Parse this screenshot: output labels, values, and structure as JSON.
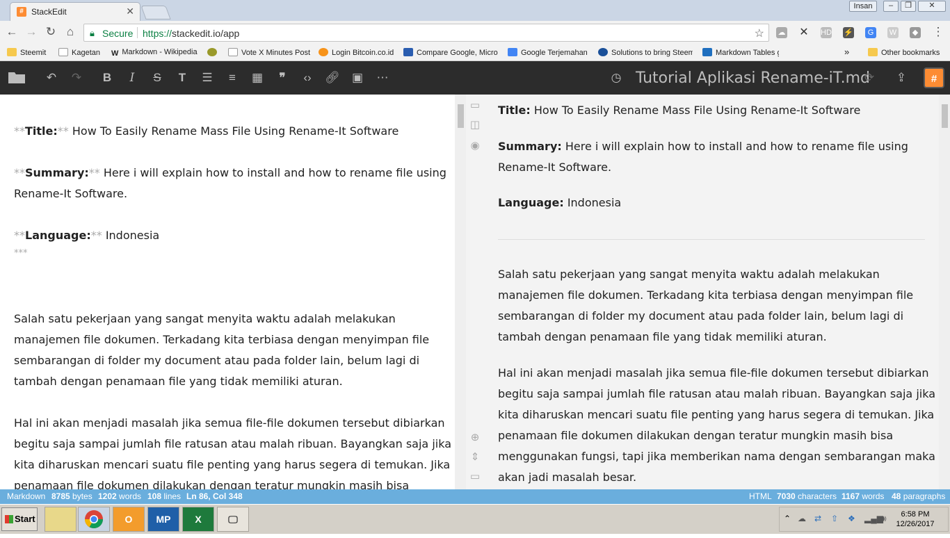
{
  "browser": {
    "tab_title": "StackEdit",
    "tab_close": "✕",
    "user": "Insan",
    "secure_label": "Secure",
    "url_scheme": "https://",
    "url_rest": "stackedit.io/app"
  },
  "bookmarks": [
    {
      "label": "Steemit",
      "icon": "folder-icon",
      "color": "#f6c94e"
    },
    {
      "label": "Kagetan",
      "icon": "page-icon",
      "color": "#ffffff"
    },
    {
      "label": "Markdown - Wikipedia",
      "icon": "wikipedia-icon",
      "color": "#ffffff"
    },
    {
      "label": "",
      "icon": "coin-icon",
      "color": "#9a9a2a"
    },
    {
      "label": "Vote X Minutes Post",
      "icon": "page-icon",
      "color": "#ffffff"
    },
    {
      "label": "Login Bitcoin.co.id",
      "icon": "bitcoin-icon",
      "color": "#f7931a"
    },
    {
      "label": "Compare Google, Micro",
      "icon": "shield-icon",
      "color": "#2a5db0"
    },
    {
      "label": "Google Terjemahan",
      "icon": "translate-icon",
      "color": "#4285f4"
    },
    {
      "label": "Solutions to bring Steem",
      "icon": "steem-icon",
      "color": "#1a5099"
    },
    {
      "label": "Markdown Tables gener",
      "icon": "table-icon",
      "color": "#1f6fbf"
    }
  ],
  "bookmarks_more": "»",
  "bookmarks_other": "Other bookmarks",
  "document_title": "Tutorial Aplikasi Rename-iT.md",
  "editor": {
    "title_mark_open": "**",
    "title_label": "Title:",
    "title_mark_close": "**",
    "title_text": " How To Easily Rename Mass File Using Rename-It Software",
    "summary_mark_open": "**",
    "summary_label": "Summary:",
    "summary_mark_close": "**",
    "summary_text": " Here i will explain how to install and how to rename file using",
    "summary_text2": "Rename-It Software.",
    "language_mark_open": "**",
    "language_label": "Language:",
    "language_mark_close": "**",
    "language_text": " Indonesia",
    "hr_mark": "***",
    "p1": [
      "Salah satu pekerjaan yang sangat menyita waktu adalah melakukan",
      "manajemen file dokumen. Terkadang kita terbiasa dengan menyimpan file",
      "sembarangan di folder my document atau pada folder lain, belum lagi di",
      "tambah dengan penamaan file yang tidak memiliki aturan."
    ],
    "p2": [
      "Hal ini akan menjadi masalah jika semua file-file dokumen tersebut dibiarkan",
      "begitu saja sampai jumlah file ratusan atau malah ribuan. Bayangkan saja jika",
      "kita diharuskan mencari suatu file penting yang harus segera di temukan. Jika",
      "penamaan file dokumen dilakukan dengan teratur mungkin masih bisa"
    ]
  },
  "preview": {
    "title_label": "Title:",
    "title_text": " How To Easily Rename Mass File Using Rename-It Software",
    "summary_label": "Summary:",
    "summary_text": " Here i will explain how to install and how to rename file using",
    "summary_text2": "Rename-It Software.",
    "language_label": "Language:",
    "language_text": " Indonesia",
    "p1": [
      "Salah satu pekerjaan yang sangat menyita waktu adalah melakukan",
      "manajemen file dokumen. Terkadang kita terbiasa dengan menyimpan file",
      "sembarangan di folder my document atau pada folder lain, belum lagi di",
      "tambah dengan penamaan file yang tidak memiliki aturan."
    ],
    "p2": [
      "Hal ini akan menjadi masalah jika semua file-file dokumen tersebut dibiarkan",
      "begitu saja sampai jumlah file ratusan atau malah ribuan. Bayangkan saja jika",
      "kita diharuskan mencari suatu file penting yang harus segera di temukan. Jika",
      "penamaan file dokumen dilakukan dengan teratur mungkin masih bisa",
      "menggunakan fungsi, tapi jika memberikan nama dengan sembarangan maka",
      "akan jadi masalah besar."
    ]
  },
  "status": {
    "left_mode": "Markdown",
    "bytes_value": "8785",
    "bytes_label": " bytes",
    "words_value": "1202",
    "words_label": " words",
    "lines_value": "108",
    "lines_label": " lines",
    "position": "Ln 86, Col 348",
    "right_mode": "HTML",
    "chars_value": "7030",
    "chars_label": " characters",
    "pwords_value": "1167",
    "pwords_label": " words",
    "paras_value": "48",
    "paras_label": " paragraphs"
  },
  "taskbar": {
    "start": "Start",
    "mp_label": "MP",
    "time": "6:58 PM",
    "date": "12/26/2017"
  },
  "colors": {
    "brand_orange": "#fd8c33",
    "toolbar_bg": "#2c2c2c",
    "status_blue": "#6aaedd",
    "secure_green": "#0b8043"
  }
}
